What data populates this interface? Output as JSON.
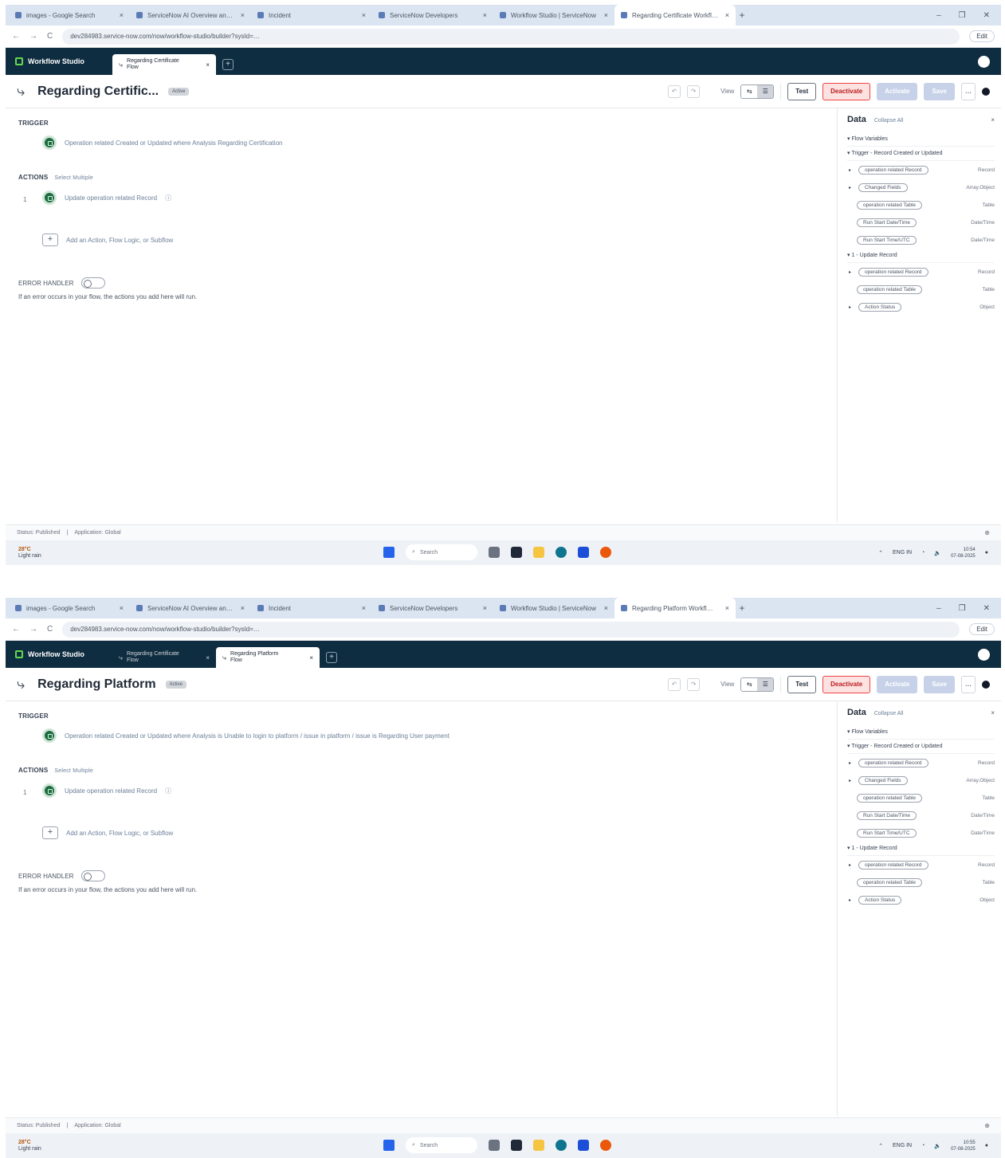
{
  "browser": {
    "tabs": [
      "images - Google Search",
      "ServiceNow AI Overview and…",
      "Incident",
      "ServiceNow Developers",
      "Workflow Studio | ServiceNow"
    ],
    "url": "dev284983.service-now.com/now/workflow-studio/builder?sysId=…",
    "edit_label": "Edit",
    "nav_back": "←",
    "nav_forward": "→",
    "nav_reload": "C",
    "win_min": "–",
    "win_max": "❐",
    "win_close": "✕"
  },
  "app": {
    "brand": "Workflow Studio",
    "tab_flow_word": "Flow",
    "close_glyph": "×",
    "add_glyph": "+"
  },
  "toolbar": {
    "view_label": "View",
    "test_label": "Test",
    "deactivate_label": "Deactivate",
    "activate_label": "Activate",
    "save_label": "Save",
    "more_label": "…",
    "undo_label": "↶",
    "redo_label": "↷",
    "view_flow_glyph": "⇆",
    "view_list_glyph": "☰"
  },
  "canvas": {
    "trigger_heading": "TRIGGER",
    "actions_heading": "ACTIONS",
    "select_multiple": "Select Multiple",
    "action_label": "Update operation related Record",
    "action_step": "1",
    "add_label": "Add an Action, Flow Logic, or Subflow",
    "error_heading": "ERROR HANDLER",
    "error_desc": "If an error occurs in your flow, the actions you add here will run."
  },
  "data_pane": {
    "title": "Data",
    "collapse": "Collapse All",
    "close": "×",
    "groups": {
      "flow_vars": "Flow Variables",
      "trigger": "Trigger - Record Created or Updated",
      "update": "1 - Update Record"
    },
    "trigger_rows": [
      {
        "label": "operation related Record",
        "type": "Record"
      },
      {
        "label": "Changed Fields",
        "type": "Array.Object"
      },
      {
        "label": "operation related Table",
        "type": "Table"
      },
      {
        "label": "Run Start Date/Time",
        "type": "Date/Time"
      },
      {
        "label": "Run Start Time/UTC",
        "type": "Date/Time"
      }
    ],
    "update_rows": [
      {
        "label": "operation related Record",
        "type": "Record"
      },
      {
        "label": "operation related Table",
        "type": "Table"
      },
      {
        "label": "Action Status",
        "type": "Object"
      }
    ]
  },
  "statusbar": {
    "status": "Status: Published",
    "application": "Application: Global",
    "zoom": "⊕"
  },
  "taskbar": {
    "temp": "28°C",
    "weather": "Light rain",
    "search": "Search",
    "lang": "ENG IN",
    "time_1": "10:54",
    "time_2": "10:55",
    "date": "07-08-2025"
  },
  "screens": [
    {
      "flow_title": "Regarding Certific...",
      "flow_badge": "Active",
      "active_app_tab": "Regarding Certificate",
      "active_browser_tab": "Regarding Certificate Workfl…",
      "trigger_desc": "Operation related Created or Updated where Analysis Regarding Certification"
    },
    {
      "flow_title": "Regarding Platform",
      "flow_badge": "Active",
      "second_app_tab": "Regarding Certificate",
      "active_app_tab": "Regarding Platform",
      "active_browser_tab": "Regarding Platform Workfl…",
      "trigger_desc": "Operation related Created or Updated where Analysis is Unable to login to platform / issue in platform / issue is Regarding User payment"
    }
  ],
  "colors": {
    "appbar": "#0f2d40",
    "accent_green": "#1f6b3f",
    "deactivate": "#b91c1c"
  }
}
